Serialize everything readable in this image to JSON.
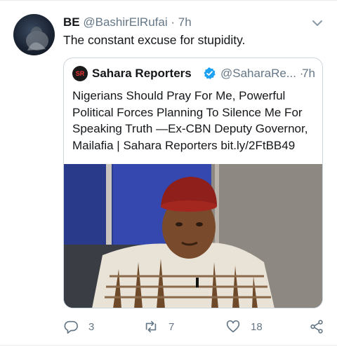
{
  "tweet": {
    "display_name": "BE",
    "handle": "@BashirElRufai",
    "separator": "·",
    "time": "7h",
    "text": "The constant excuse for stupidity."
  },
  "quoted_tweet": {
    "avatar_letters": "SR",
    "display_name": "Sahara Reporters",
    "handle": "@SaharaRe...",
    "separator": "·",
    "time": "7h",
    "text": "Nigerians Should Pray For Me, Powerful Political Forces Planning To Silence Me For Speaking Truth —Ex-CBN Deputy Governor, Mailafia | Sahara Reporters bit.ly/2FtBB49"
  },
  "actions": {
    "reply_count": "3",
    "retweet_count": "7",
    "like_count": "18"
  },
  "colors": {
    "verified_blue": "#1da1f2",
    "secondary_text": "#657786",
    "border": "#ccd6dd"
  },
  "icons": [
    "chevron-down-icon",
    "verified-badge-icon",
    "reply-icon",
    "retweet-icon",
    "like-icon",
    "share-icon"
  ]
}
